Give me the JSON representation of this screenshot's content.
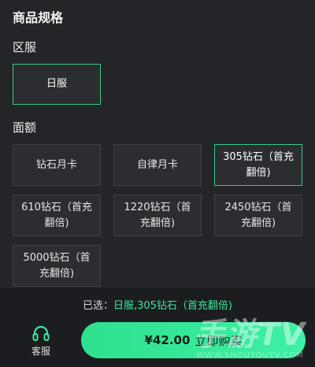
{
  "header": {
    "title": "商品规格"
  },
  "region": {
    "label": "区服",
    "options": [
      {
        "label": "日服",
        "selected": true
      }
    ]
  },
  "amount": {
    "label": "面额",
    "options": [
      {
        "label": "钻石月卡",
        "selected": false
      },
      {
        "label": "自律月卡",
        "selected": false
      },
      {
        "label": "305钻石（首充翻倍)",
        "selected": true
      },
      {
        "label": "610钻石（首充翻倍)",
        "selected": false
      },
      {
        "label": "1220钻石（首充翻倍)",
        "selected": false
      },
      {
        "label": "2450钻石（首充翻倍)",
        "selected": false
      },
      {
        "label": "5000钻石（首充翻倍)",
        "selected": false
      }
    ]
  },
  "footer": {
    "selected_prefix": "已选：",
    "selected_value": "日服,305钻石（首充翻倍)",
    "customer_service_label": "客服",
    "buy_price": "¥42.00",
    "buy_label": "立即购买"
  },
  "watermark": {
    "text": "手游TV",
    "url_text": "WWW.SHOUYOUTV.COM"
  },
  "colors": {
    "accent": "#37c98a",
    "selected_text": "#3ee59a",
    "button": "#2fe08d",
    "background": "#232528"
  },
  "icons": {
    "customer_service": "headset-icon"
  }
}
